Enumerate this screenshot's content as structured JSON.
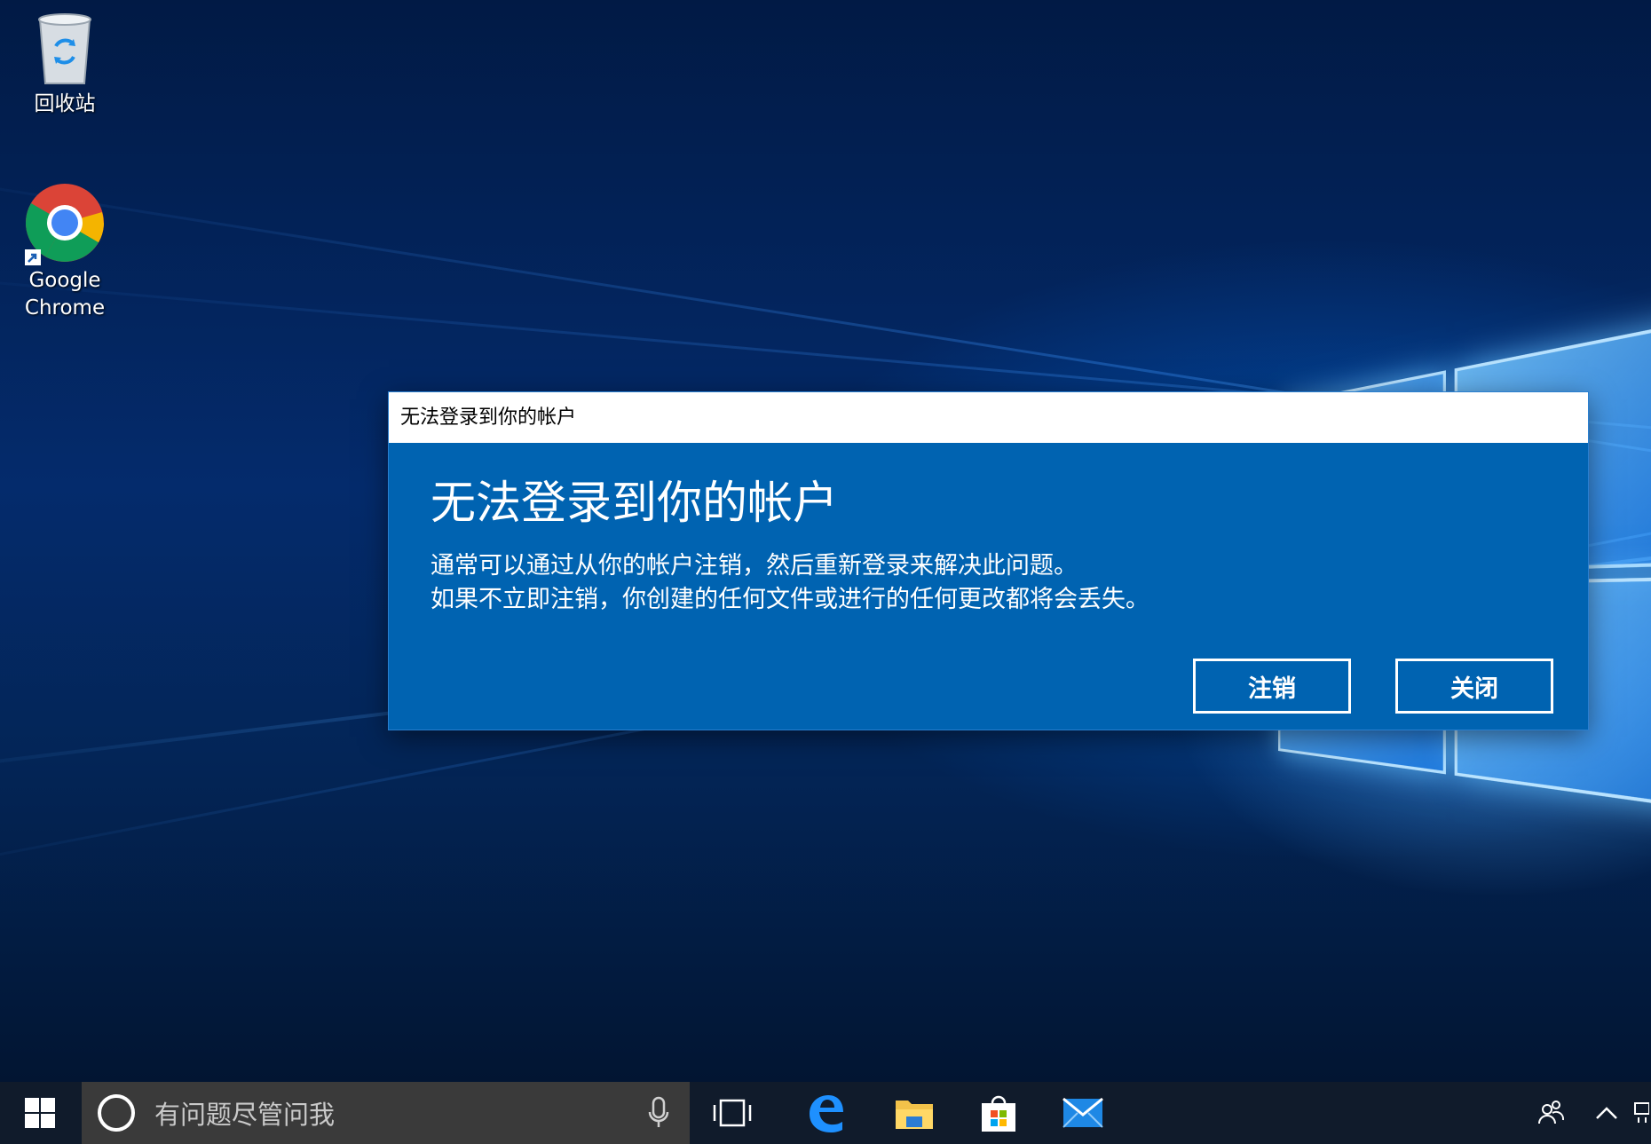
{
  "desktop": {
    "icons": [
      {
        "label": "回收站",
        "icon": "recycle-bin-icon"
      },
      {
        "label_line1": "Google",
        "label_line2": "Chrome",
        "icon": "chrome-icon"
      }
    ]
  },
  "dialog": {
    "window_title": "无法登录到你的帐户",
    "heading": "无法登录到你的帐户",
    "message_line1": "通常可以通过从你的帐户注销，然后重新登录来解决此问题。",
    "message_line2": "如果不立即注销，你创建的任何文件或进行的任何更改都将会丢失。",
    "signout_button": "注销",
    "close_button": "关闭",
    "colors": {
      "background": "#0063b1",
      "titlebar": "#ffffff"
    }
  },
  "taskbar": {
    "search_placeholder": "有问题尽管问我",
    "pinned": [
      "task-view-icon",
      "edge-icon",
      "file-explorer-icon",
      "store-icon",
      "mail-icon"
    ],
    "tray": [
      "people-icon",
      "show-hidden-icons-chevron"
    ]
  }
}
